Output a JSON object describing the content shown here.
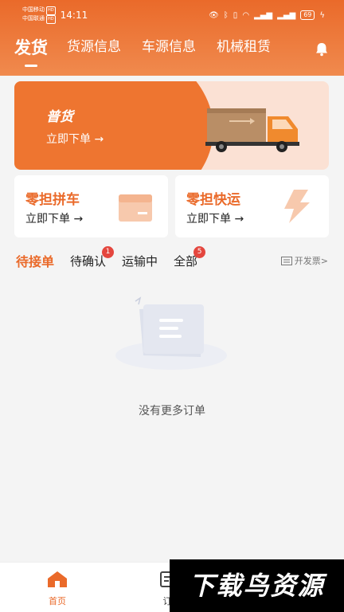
{
  "status_bar": {
    "carrier1": "中国移动",
    "carrier2": "中国联通",
    "hd_tag": "HD",
    "time": "14:11",
    "battery": "69"
  },
  "nav": {
    "tabs": [
      {
        "label": "发货",
        "active": true
      },
      {
        "label": "货源信息",
        "active": false
      },
      {
        "label": "车源信息",
        "active": false
      },
      {
        "label": "机械租赁",
        "active": false
      }
    ],
    "bell_icon": "bell-icon"
  },
  "banner": {
    "title": "普货",
    "cta": "立即下单 →"
  },
  "services": [
    {
      "title": "零担拼车",
      "cta": "立即下单 →",
      "icon": "box-icon"
    },
    {
      "title": "零担快运",
      "cta": "立即下单 →",
      "icon": "lightning-icon"
    }
  ],
  "order_tabs": [
    {
      "label": "待接单",
      "active": true,
      "badge": ""
    },
    {
      "label": "待确认",
      "active": false,
      "badge": "1"
    },
    {
      "label": "运输中",
      "active": false,
      "badge": ""
    },
    {
      "label": "全部",
      "active": false,
      "badge": "5"
    }
  ],
  "invoice_link": "开发票>",
  "empty_message": "没有更多订单",
  "bottom_nav": [
    {
      "label": "首页",
      "icon": "home-icon",
      "active": true
    },
    {
      "label": "订",
      "icon": "order-icon",
      "active": false
    }
  ],
  "watermark": "下载鸟资源",
  "colors": {
    "accent": "#ea6a2a",
    "badge": "#e4463e",
    "banner_bg": "#fbe1d4"
  }
}
